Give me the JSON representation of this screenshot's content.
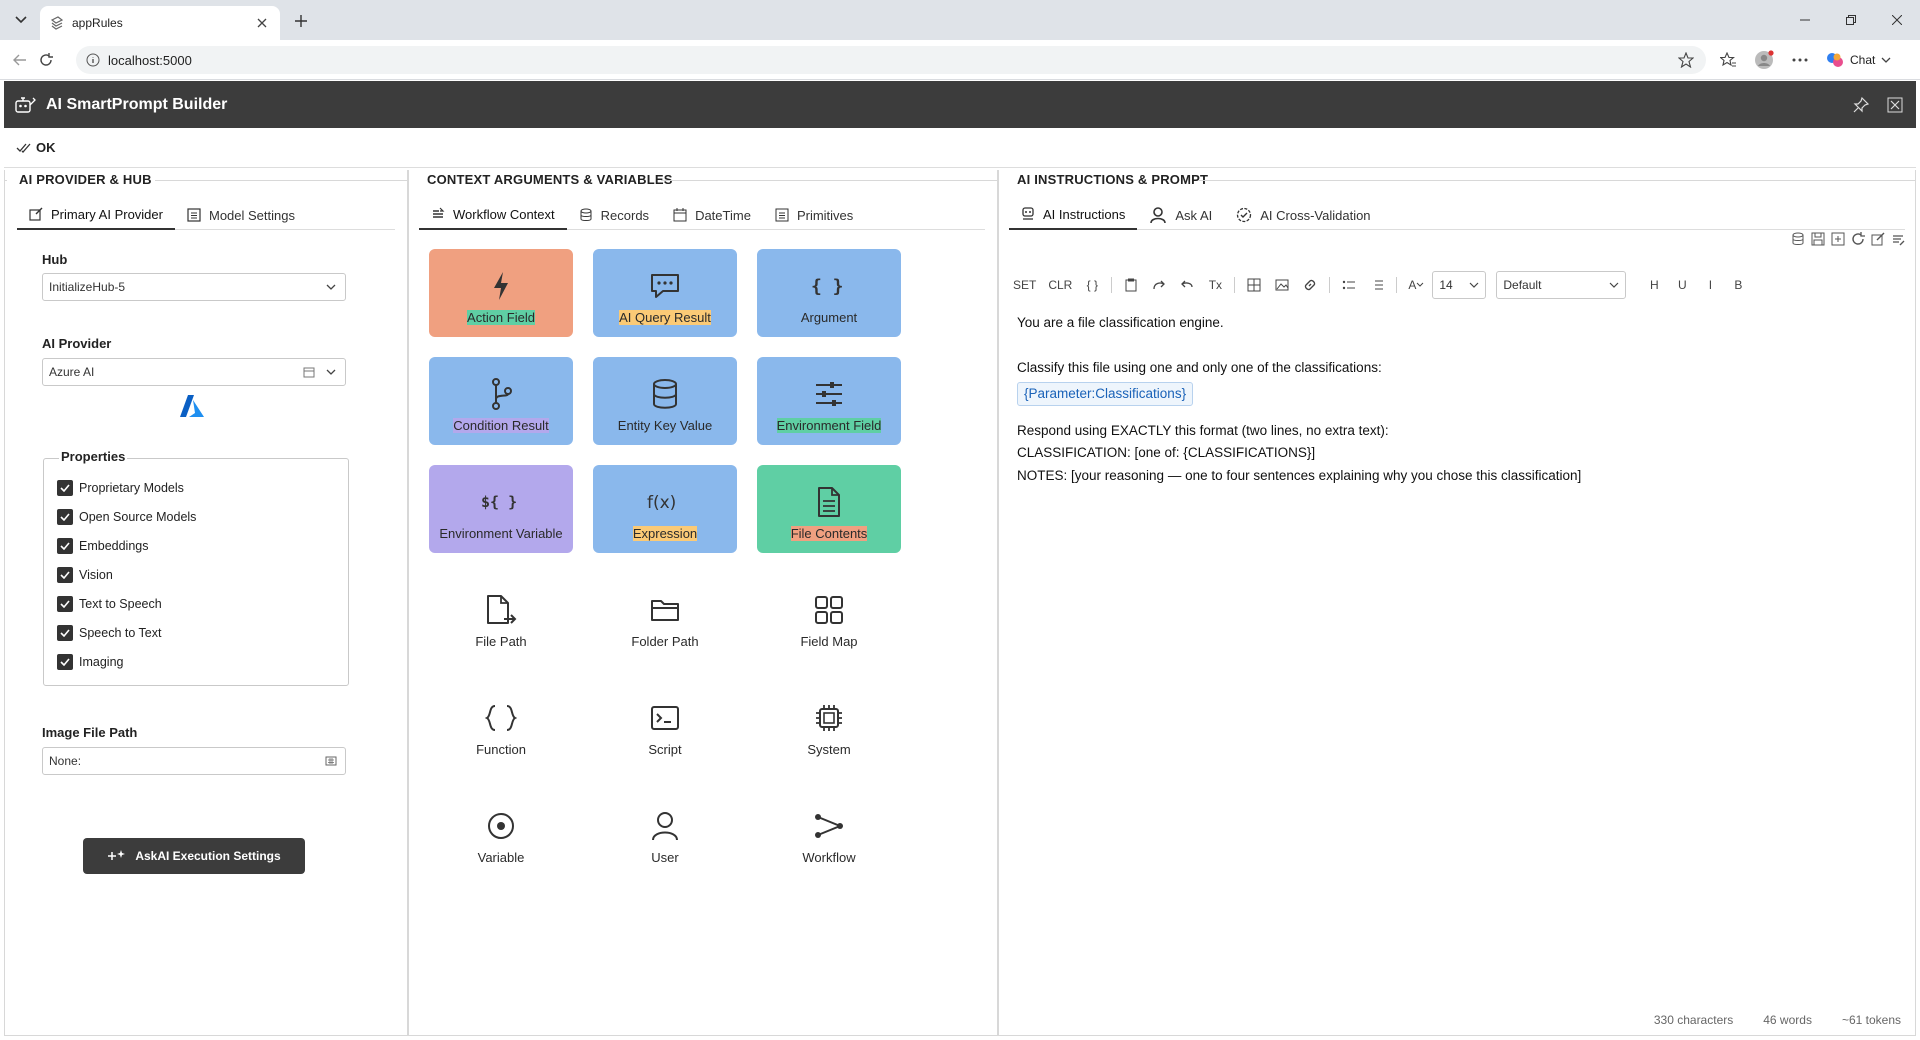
{
  "browser": {
    "tab_title": "appRules",
    "url": "localhost:5000",
    "chat_label": "Chat"
  },
  "app": {
    "title": "AI SmartPrompt Builder",
    "ok_label": "OK"
  },
  "left_panel": {
    "title": "AI PROVIDER & HUB",
    "tabs": [
      "Primary AI Provider",
      "Model Settings"
    ],
    "hub_label": "Hub",
    "hub_value": "InitializeHub-5",
    "provider_label": "AI Provider",
    "provider_value": "Azure AI",
    "properties_label": "Properties",
    "properties": [
      {
        "label": "Proprietary Models",
        "checked": true
      },
      {
        "label": "Open Source Models",
        "checked": true
      },
      {
        "label": "Embeddings",
        "checked": true
      },
      {
        "label": "Vision",
        "checked": true
      },
      {
        "label": "Text to Speech",
        "checked": true
      },
      {
        "label": "Speech to Text",
        "checked": true
      },
      {
        "label": "Imaging",
        "checked": true
      }
    ],
    "image_path_label": "Image File Path",
    "image_path_value": "None:",
    "execution_button": "AskAI Execution Settings"
  },
  "middle_panel": {
    "title": "CONTEXT ARGUMENTS & VARIABLES",
    "tabs": [
      "Workflow Context",
      "Records",
      "DateTime",
      "Primitives"
    ],
    "tiles": [
      {
        "label": "Action Field",
        "color": "#f0a080",
        "icon": "lightning-icon"
      },
      {
        "label": "AI Query Result",
        "color": "#5fcfa4",
        "icon": "chat-bubble-icon"
      },
      {
        "label": "Argument",
        "color": "#8ab8ec",
        "icon": "braces-icon"
      },
      {
        "label": "Condition Result",
        "color": "#fbca76",
        "icon": "branch-icon"
      },
      {
        "label": "Entity Key Value",
        "color": "#8ab8ec",
        "icon": "database-icon"
      },
      {
        "label": "Environment Field",
        "color": "#8ab8ec",
        "icon": "sliders-icon"
      },
      {
        "label": "Environment Variable",
        "color": "#8ab8ec",
        "icon": "dollar-braces-icon"
      },
      {
        "label": "Expression",
        "color": "#b3a8ec",
        "icon": "fx-icon"
      },
      {
        "label": "File Contents",
        "color": "#8ab8ec",
        "icon": "document-icon"
      },
      {
        "label": "File Path",
        "color": "#8ab8ec",
        "icon": "file-arrow-icon"
      },
      {
        "label": "Folder Path",
        "color": "#8ab8ec",
        "icon": "folder-icon"
      },
      {
        "label": "Field Map",
        "color": "#5fcfa4",
        "icon": "grid-icon"
      },
      {
        "label": "Function",
        "color": "#b3a8ec",
        "icon": "curly-icon"
      },
      {
        "label": "Script",
        "color": "#b3a8ec",
        "icon": "terminal-icon"
      },
      {
        "label": "System",
        "color": "#8ab8ec",
        "icon": "chip-icon"
      },
      {
        "label": "Variable",
        "color": "#fbca76",
        "icon": "target-icon"
      },
      {
        "label": "User",
        "color": "#5fcfa4",
        "icon": "user-icon"
      },
      {
        "label": "Workflow",
        "color": "#f0a080",
        "icon": "workflow-icon"
      }
    ]
  },
  "right_panel": {
    "title": "AI INSTRUCTIONS & PROMPT",
    "tabs": [
      "AI Instructions",
      "Ask AI",
      "AI Cross-Validation"
    ],
    "toolbar": {
      "set_label": "SET",
      "clr_label": "CLR",
      "braces_label": "{ }",
      "tx_label": "Tx",
      "font_color_label": "A",
      "font_size": "14",
      "font_family": "Default",
      "h_label": "H",
      "u_label": "U",
      "i_label": "I",
      "b_label": "B"
    },
    "editor": {
      "line1": "You are a file classification engine.",
      "line2": "Classify this file using one and only one of the classifications:",
      "param": "{Parameter:Classifications}",
      "line3": "Respond using EXACTLY this format (two lines, no extra text):",
      "line4": "CLASSIFICATION: [one of: {CLASSIFICATIONS}]",
      "line5": "NOTES: [your reasoning — one to four sentences explaining why you chose this classification]"
    },
    "status": {
      "characters": "330 characters",
      "words": "46 words",
      "tokens": "~61 tokens"
    }
  }
}
